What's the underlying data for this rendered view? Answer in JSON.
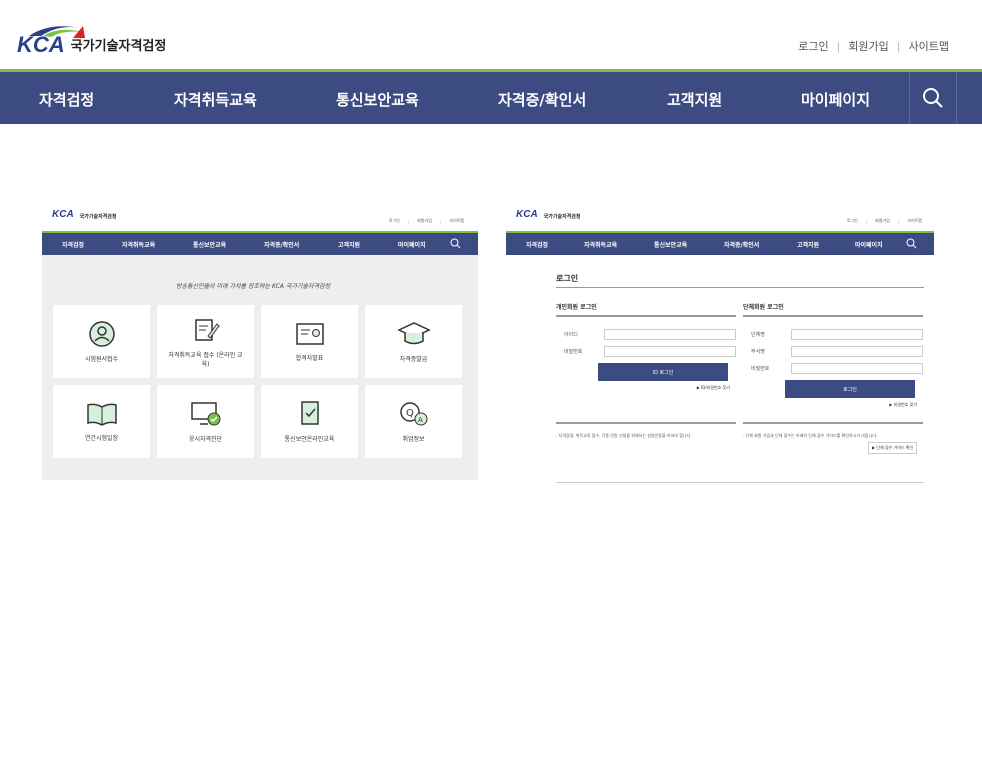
{
  "site": {
    "logo": "KCA",
    "name": "국가기술자격검정"
  },
  "util": [
    "로그인",
    "회원가입",
    "사이트맵"
  ],
  "nav": [
    "자격검정",
    "자격취득교육",
    "통신보안교육",
    "자격증/확인서",
    "고객지원",
    "마이페이지"
  ],
  "left": {
    "slogan": "방송통신인들의 미래 가치를 창조하는 KCA 국가기술자격검정",
    "cards": [
      "시험원서접수",
      "자격취득교육 접수 (온라인 교육)",
      "합격자발표",
      "자격증발급",
      "연간시험일정",
      "응시자격진단",
      "통신보안온라인교육",
      "취업정보"
    ]
  },
  "right": {
    "title": "로그인",
    "personal": "개인회원 로그인",
    "group": "단체회원 로그인",
    "id": "아이디",
    "pw": "비밀번호",
    "corp": "단체명",
    "dept": "부서명",
    "gpw": "비밀번호",
    "login_btn": "ID 로그인",
    "group_btn": "로그인",
    "find1": "▶ ID/비밀번호 찾기",
    "find2": "▶ 비밀번호 찾기",
    "note1": "· 자격검정, 취득교육 접수, 각종 민원 신청을 위해서는 실명인증을 하셔야 합니다.",
    "note2": "· 단체 회원 가입과 단체 접수는 아래의 단체 접수 가이드를 확인하시기 바랍니다.",
    "guide": "▶ 단체 접수 가이드 확인"
  }
}
